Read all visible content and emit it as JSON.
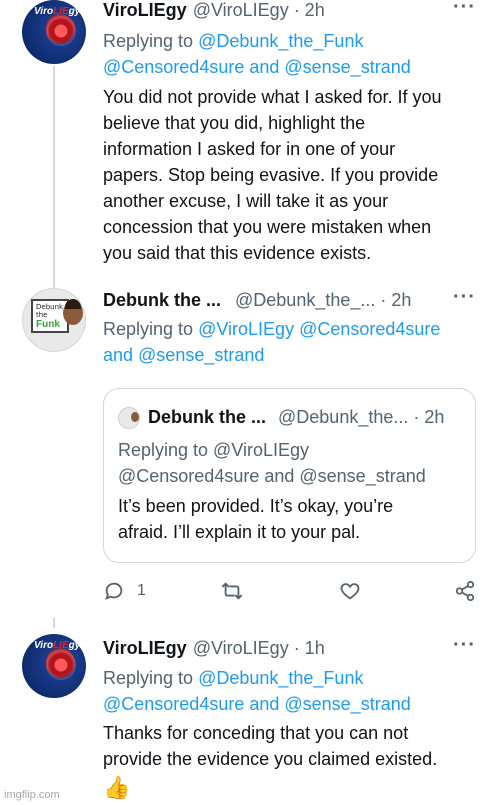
{
  "tweet1": {
    "display_name": "ViroLIEgy",
    "handle": "@ViroLIEgy · 2h",
    "replying_to": "Replying to",
    "reply_link_1": "@Debunk_the_Funk",
    "reply_link_2": "@Censored4sure and @sense_strand",
    "body_lines": [
      "You did not provide what I asked for. If you",
      "believe that you did, highlight the",
      "information I asked for in one of your",
      "papers. Stop being evasive. If you provide",
      "another excuse, I will take it as your",
      "concession that you were mistaken when",
      "you said that this evidence exists."
    ],
    "avatar_logo": "ViroLIEgy",
    "more_icon": "more-horizontal-icon"
  },
  "tweet2": {
    "display_name": "Debunk the ...",
    "handle": "@Debunk_the_... · 2h",
    "replying_to": "Replying to",
    "reply_link_1": "@ViroLIEgy @Censored4sure",
    "reply_link_2": "and @sense_strand",
    "avatar_board_text_1": "Debunk",
    "avatar_board_text_2": "the",
    "avatar_board_text_3": "Funk",
    "quote": {
      "display_name": "Debunk the ...",
      "handle": "@Debunk_the... · 2h",
      "reply_line_1": "Replying to @ViroLIEgy",
      "reply_line_2": "@Censored4sure and @sense_strand",
      "body_lines": [
        "It’s been provided. It’s okay, you’re",
        "afraid. I’ll explain it to your pal."
      ]
    },
    "actions": {
      "reply_count": "1",
      "reply_icon": "reply-icon",
      "retweet_icon": "retweet-icon",
      "like_icon": "heart-icon",
      "share_icon": "share-icon"
    }
  },
  "tweet3": {
    "display_name": "ViroLIEgy",
    "handle": "@ViroLIEgy · 1h",
    "replying_to": "Replying to",
    "reply_link_1": "@Debunk_the_Funk",
    "reply_link_2": "@Censored4sure and @sense_strand",
    "body_lines": [
      "Thanks for conceding that you can not",
      "provide the evidence you claimed existed."
    ],
    "emoji": "👍"
  },
  "watermark": "imgflip.com",
  "colors": {
    "link": "#1d9bf0",
    "muted": "#536471",
    "text": "#0f1419",
    "border": "#cfd9de"
  }
}
